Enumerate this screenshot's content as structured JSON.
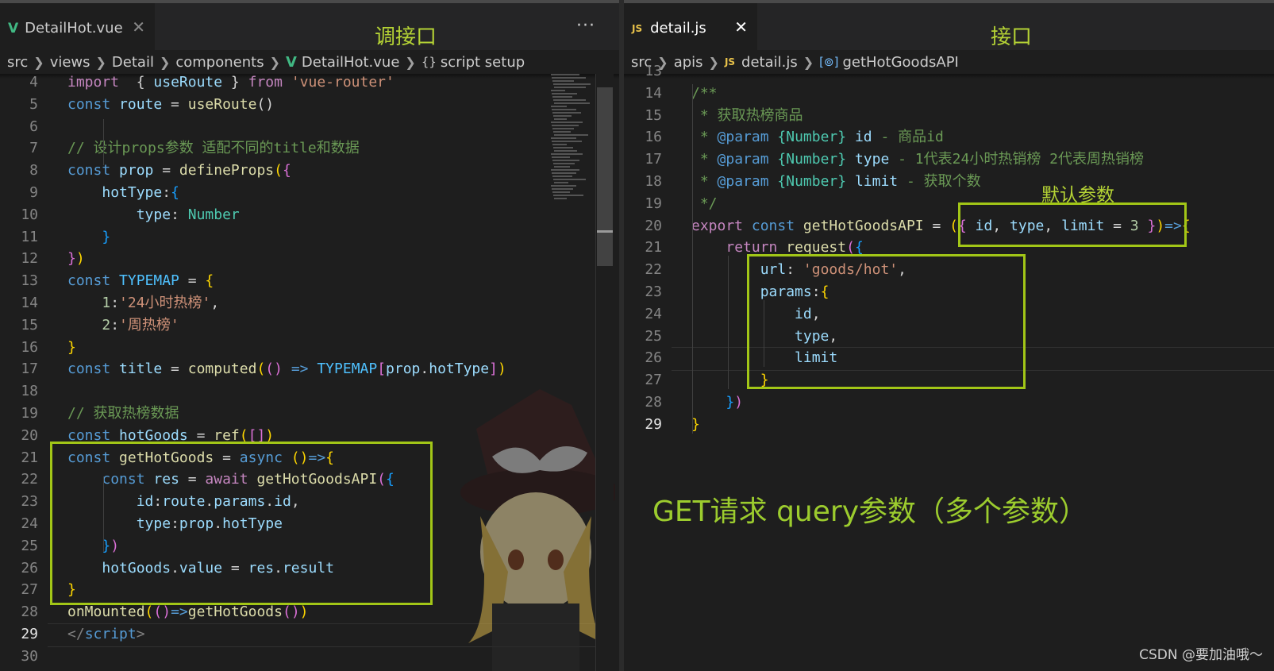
{
  "left_editor": {
    "tab": {
      "icon": "vue-icon",
      "label": "DetailHot.vue",
      "close": "✕"
    },
    "more_actions": "···",
    "annotation": "调接口",
    "breadcrumb": [
      "src",
      "views",
      "Detail",
      "components",
      "DetailHot.vue",
      "script setup"
    ],
    "lines": [
      {
        "n": "4",
        "tokens": [
          [
            "import",
            "kw"
          ],
          [
            "  { ",
            "pl"
          ],
          [
            "useRoute",
            "var"
          ],
          [
            " } ",
            "pl"
          ],
          [
            "from",
            "kw"
          ],
          [
            " ",
            "pl"
          ],
          [
            "'vue-router'",
            "str"
          ]
        ]
      },
      {
        "n": "5",
        "tokens": [
          [
            "const",
            "kw2"
          ],
          [
            " ",
            "pl"
          ],
          [
            "route",
            "var"
          ],
          [
            " = ",
            "pl"
          ],
          [
            "useRoute",
            "fn"
          ],
          [
            "()",
            "pl"
          ]
        ]
      },
      {
        "n": "6",
        "tokens": []
      },
      {
        "n": "7",
        "tokens": [
          [
            "// 设计props参数 适配不同的title和数据",
            "cmt"
          ]
        ]
      },
      {
        "n": "8",
        "tokens": [
          [
            "const",
            "kw2"
          ],
          [
            " ",
            "pl"
          ],
          [
            "prop",
            "var"
          ],
          [
            " = ",
            "pl"
          ],
          [
            "defineProps",
            "fn"
          ],
          [
            "(",
            "br1"
          ],
          [
            "{",
            "br2"
          ]
        ]
      },
      {
        "n": "9",
        "tokens": [
          [
            "    ",
            "pl"
          ],
          [
            "hotType",
            "var"
          ],
          [
            ":",
            "pl"
          ],
          [
            "{",
            "br3"
          ]
        ]
      },
      {
        "n": "10",
        "tokens": [
          [
            "        ",
            "pl"
          ],
          [
            "type",
            "var"
          ],
          [
            ": ",
            "pl"
          ],
          [
            "Number",
            "type"
          ]
        ]
      },
      {
        "n": "11",
        "tokens": [
          [
            "    ",
            "pl"
          ],
          [
            "}",
            "br3"
          ]
        ]
      },
      {
        "n": "12",
        "tokens": [
          [
            "}",
            "br2"
          ],
          [
            ")",
            "br1"
          ]
        ]
      },
      {
        "n": "13",
        "tokens": [
          [
            "const",
            "kw2"
          ],
          [
            " ",
            "pl"
          ],
          [
            "TYPEMAP",
            "const"
          ],
          [
            " = ",
            "pl"
          ],
          [
            "{",
            "br1"
          ]
        ]
      },
      {
        "n": "14",
        "tokens": [
          [
            "    ",
            "pl"
          ],
          [
            "1",
            "num"
          ],
          [
            ":",
            "pl"
          ],
          [
            "'24小时热榜'",
            "str"
          ],
          [
            ",",
            "pl"
          ]
        ]
      },
      {
        "n": "15",
        "tokens": [
          [
            "    ",
            "pl"
          ],
          [
            "2",
            "num"
          ],
          [
            ":",
            "pl"
          ],
          [
            "'周热榜'",
            "str"
          ]
        ]
      },
      {
        "n": "16",
        "tokens": [
          [
            "}",
            "br1"
          ]
        ]
      },
      {
        "n": "17",
        "tokens": [
          [
            "const",
            "kw2"
          ],
          [
            " ",
            "pl"
          ],
          [
            "title",
            "var"
          ],
          [
            " = ",
            "pl"
          ],
          [
            "computed",
            "fn"
          ],
          [
            "(",
            "br1"
          ],
          [
            "()",
            "br2"
          ],
          [
            " ",
            "pl"
          ],
          [
            "=>",
            "kw2"
          ],
          [
            " ",
            "pl"
          ],
          [
            "TYPEMAP",
            "const"
          ],
          [
            "[",
            "br2"
          ],
          [
            "prop",
            "var"
          ],
          [
            ".",
            "pl"
          ],
          [
            "hotType",
            "var"
          ],
          [
            "]",
            "br2"
          ],
          [
            ")",
            "br1"
          ]
        ]
      },
      {
        "n": "18",
        "tokens": []
      },
      {
        "n": "19",
        "tokens": [
          [
            "// 获取热榜数据",
            "cmt"
          ]
        ]
      },
      {
        "n": "20",
        "tokens": [
          [
            "const",
            "kw2"
          ],
          [
            " ",
            "pl"
          ],
          [
            "hotGoods",
            "var"
          ],
          [
            " = ",
            "pl"
          ],
          [
            "ref",
            "fn"
          ],
          [
            "(",
            "br1"
          ],
          [
            "[]",
            "br2"
          ],
          [
            ")",
            "br1"
          ]
        ]
      },
      {
        "n": "21",
        "tokens": [
          [
            "const",
            "kw2"
          ],
          [
            " ",
            "pl"
          ],
          [
            "getHotGoods",
            "fn"
          ],
          [
            " = ",
            "pl"
          ],
          [
            "async",
            "kw2"
          ],
          [
            " ",
            "pl"
          ],
          [
            "()",
            "br1"
          ],
          [
            "=>",
            "kw2"
          ],
          [
            "{",
            "br1"
          ]
        ]
      },
      {
        "n": "22",
        "tokens": [
          [
            "    ",
            "pl"
          ],
          [
            "const",
            "kw2"
          ],
          [
            " ",
            "pl"
          ],
          [
            "res",
            "var"
          ],
          [
            " = ",
            "pl"
          ],
          [
            "await",
            "kw"
          ],
          [
            " ",
            "pl"
          ],
          [
            "getHotGoodsAPI",
            "fn"
          ],
          [
            "(",
            "br2"
          ],
          [
            "{",
            "br3"
          ]
        ]
      },
      {
        "n": "23",
        "tokens": [
          [
            "        ",
            "pl"
          ],
          [
            "id",
            "var"
          ],
          [
            ":",
            "pl"
          ],
          [
            "route",
            "var"
          ],
          [
            ".",
            "pl"
          ],
          [
            "params",
            "var"
          ],
          [
            ".",
            "pl"
          ],
          [
            "id",
            "var"
          ],
          [
            ",",
            "pl"
          ]
        ]
      },
      {
        "n": "24",
        "tokens": [
          [
            "        ",
            "pl"
          ],
          [
            "type",
            "var"
          ],
          [
            ":",
            "pl"
          ],
          [
            "prop",
            "var"
          ],
          [
            ".",
            "pl"
          ],
          [
            "hotType",
            "var"
          ]
        ]
      },
      {
        "n": "25",
        "tokens": [
          [
            "    ",
            "pl"
          ],
          [
            "}",
            "br3"
          ],
          [
            ")",
            "br2"
          ]
        ]
      },
      {
        "n": "26",
        "tokens": [
          [
            "    ",
            "pl"
          ],
          [
            "hotGoods",
            "var"
          ],
          [
            ".",
            "pl"
          ],
          [
            "value",
            "var"
          ],
          [
            " = ",
            "pl"
          ],
          [
            "res",
            "var"
          ],
          [
            ".",
            "pl"
          ],
          [
            "result",
            "var"
          ]
        ]
      },
      {
        "n": "27",
        "tokens": [
          [
            "}",
            "br1"
          ]
        ]
      },
      {
        "n": "28",
        "tokens": [
          [
            "onMounted",
            "fn"
          ],
          [
            "(",
            "br1"
          ],
          [
            "()",
            "br2"
          ],
          [
            "=>",
            "kw2"
          ],
          [
            "getHotGoods",
            "fn"
          ],
          [
            "()",
            "br2"
          ],
          [
            ")",
            "br1"
          ]
        ]
      },
      {
        "n": "29",
        "tokens": [
          [
            "</",
            "tag"
          ],
          [
            "script",
            "tagn"
          ],
          [
            ">",
            "tag"
          ]
        ]
      },
      {
        "n": "30",
        "tokens": []
      }
    ]
  },
  "right_editor": {
    "tab": {
      "icon": "js-icon",
      "icon_text": "JS",
      "label": "detail.js",
      "close": "✕"
    },
    "annotation": "接口",
    "breadcrumb": [
      "src",
      "apis",
      "detail.js",
      "getHotGoodsAPI"
    ],
    "box_label": "默认参数",
    "bottom_annotation": "GET请求 query参数（多个参数）",
    "lines": [
      {
        "n": "13",
        "tokens": []
      },
      {
        "n": "14",
        "tokens": [
          [
            "/**",
            "cmt"
          ]
        ]
      },
      {
        "n": "15",
        "tokens": [
          [
            " * 获取热榜商品",
            "cmt"
          ]
        ]
      },
      {
        "n": "16",
        "tokens": [
          [
            " * ",
            "cmt"
          ],
          [
            "@param",
            "kw2"
          ],
          [
            " ",
            "cmt"
          ],
          [
            "{Number}",
            "type"
          ],
          [
            " ",
            "cmt"
          ],
          [
            "id",
            "var"
          ],
          [
            " - 商品id",
            "cmt"
          ]
        ]
      },
      {
        "n": "17",
        "tokens": [
          [
            " * ",
            "cmt"
          ],
          [
            "@param",
            "kw2"
          ],
          [
            " ",
            "cmt"
          ],
          [
            "{Number}",
            "type"
          ],
          [
            " ",
            "cmt"
          ],
          [
            "type",
            "var"
          ],
          [
            " - 1代表24小时热销榜 2代表周热销榜",
            "cmt"
          ]
        ]
      },
      {
        "n": "18",
        "tokens": [
          [
            " * ",
            "cmt"
          ],
          [
            "@param",
            "kw2"
          ],
          [
            " ",
            "cmt"
          ],
          [
            "{Number}",
            "type"
          ],
          [
            " ",
            "cmt"
          ],
          [
            "limit",
            "var"
          ],
          [
            " - 获取个数",
            "cmt"
          ]
        ]
      },
      {
        "n": "19",
        "tokens": [
          [
            " */",
            "cmt"
          ]
        ]
      },
      {
        "n": "20",
        "tokens": [
          [
            "export",
            "kw"
          ],
          [
            " ",
            "pl"
          ],
          [
            "const",
            "kw2"
          ],
          [
            " ",
            "pl"
          ],
          [
            "getHotGoodsAPI",
            "fn"
          ],
          [
            " = ",
            "pl"
          ],
          [
            "(",
            "br1"
          ],
          [
            "{",
            "br2"
          ],
          [
            " ",
            "pl"
          ],
          [
            "id",
            "var"
          ],
          [
            ", ",
            "pl"
          ],
          [
            "type",
            "var"
          ],
          [
            ", ",
            "pl"
          ],
          [
            "limit",
            "var"
          ],
          [
            " = ",
            "pl"
          ],
          [
            "3",
            "num"
          ],
          [
            " ",
            "pl"
          ],
          [
            "}",
            "br2"
          ],
          [
            ")",
            "br1"
          ],
          [
            "=>",
            "kw2"
          ],
          [
            "{",
            "br1"
          ]
        ]
      },
      {
        "n": "21",
        "tokens": [
          [
            "    ",
            "pl"
          ],
          [
            "return",
            "kw"
          ],
          [
            " ",
            "pl"
          ],
          [
            "request",
            "fn"
          ],
          [
            "(",
            "br2"
          ],
          [
            "{",
            "br3"
          ]
        ]
      },
      {
        "n": "22",
        "tokens": [
          [
            "        ",
            "pl"
          ],
          [
            "url",
            "var"
          ],
          [
            ": ",
            "pl"
          ],
          [
            "'goods/hot'",
            "str"
          ],
          [
            ",",
            "pl"
          ]
        ]
      },
      {
        "n": "23",
        "tokens": [
          [
            "        ",
            "pl"
          ],
          [
            "params",
            "var"
          ],
          [
            ":",
            "pl"
          ],
          [
            "{",
            "br1"
          ]
        ]
      },
      {
        "n": "24",
        "tokens": [
          [
            "            ",
            "pl"
          ],
          [
            "id",
            "var"
          ],
          [
            ",",
            "pl"
          ]
        ]
      },
      {
        "n": "25",
        "tokens": [
          [
            "            ",
            "pl"
          ],
          [
            "type",
            "var"
          ],
          [
            ",",
            "pl"
          ]
        ]
      },
      {
        "n": "26",
        "tokens": [
          [
            "            ",
            "pl"
          ],
          [
            "limit",
            "var"
          ]
        ]
      },
      {
        "n": "27",
        "tokens": [
          [
            "        ",
            "pl"
          ],
          [
            "}",
            "br1"
          ]
        ]
      },
      {
        "n": "28",
        "tokens": [
          [
            "    ",
            "pl"
          ],
          [
            "}",
            "br3"
          ],
          [
            ")",
            "br2"
          ]
        ]
      },
      {
        "n": "29",
        "tokens": [
          [
            "}",
            "br1"
          ]
        ]
      }
    ]
  },
  "watermark": "CSDN @要加油哦～",
  "colors": {
    "kw": "#c586c0",
    "kw2": "#569cd6",
    "var": "#9cdcfe",
    "fn": "#dcdcaa",
    "str": "#ce9178",
    "cmt": "#6a9955",
    "num": "#b5cea8",
    "type": "#4ec9b0",
    "const": "#4fc1ff",
    "pl": "#d4d4d4",
    "br1": "#ffd700",
    "br2": "#da70d6",
    "br3": "#179fff",
    "tag": "#808080",
    "tagn": "#569cd6",
    "annotation": "#b5d335",
    "box": "#a2c617"
  }
}
